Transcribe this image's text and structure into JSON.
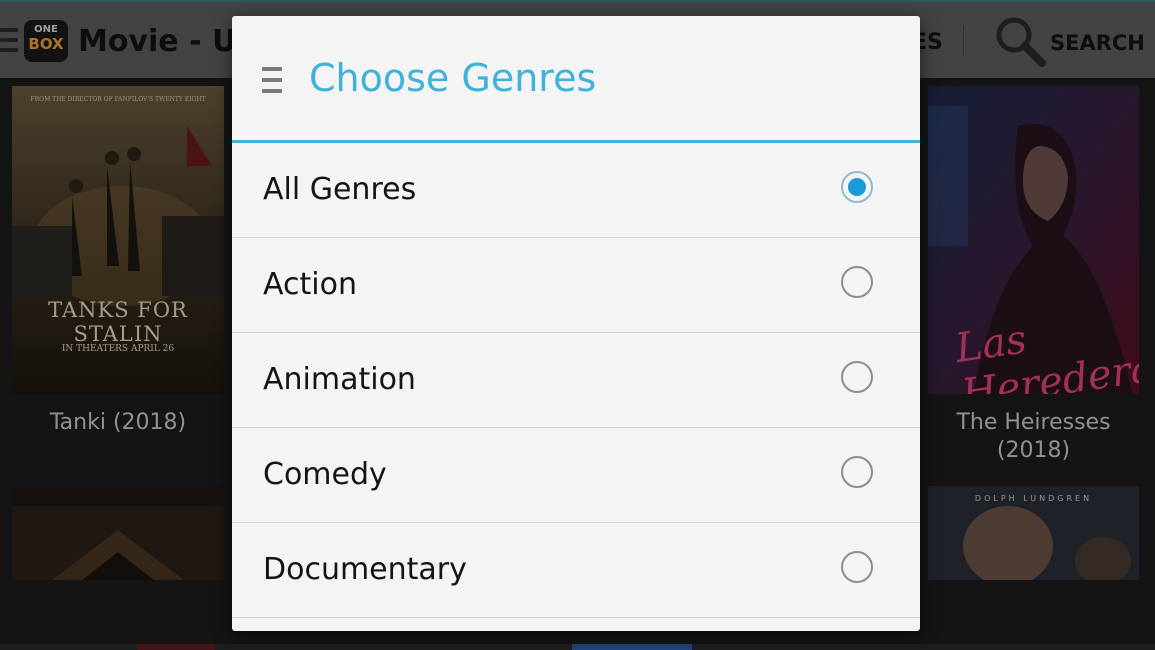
{
  "actionbar": {
    "logo_top": "ONE",
    "logo_bottom": "BOX",
    "title": "Movie - Up",
    "genres_fragment": "ES",
    "search_label": "SEARCH"
  },
  "posters": {
    "tanki": {
      "tagline": "FROM THE DIRECTOR OF PANFILOV'S TWENTY EIGHT",
      "title_art": "TANKS FOR STALIN",
      "release_art": "IN THEATERS APRIL 26",
      "caption": "Tanki (2018)"
    },
    "heiresses": {
      "script_art": "Las Herederas",
      "caption_line1": "The Heiresses",
      "caption_line2": "(2018)"
    },
    "dolph": {
      "credit_art": "DOLPH LUNDGREN"
    }
  },
  "dialog": {
    "title": "Choose Genres",
    "accent_color": "#3fb2d9",
    "options": [
      {
        "label": "All Genres",
        "selected": true
      },
      {
        "label": "Action",
        "selected": false
      },
      {
        "label": "Animation",
        "selected": false
      },
      {
        "label": "Comedy",
        "selected": false
      },
      {
        "label": "Documentary",
        "selected": false
      }
    ]
  }
}
